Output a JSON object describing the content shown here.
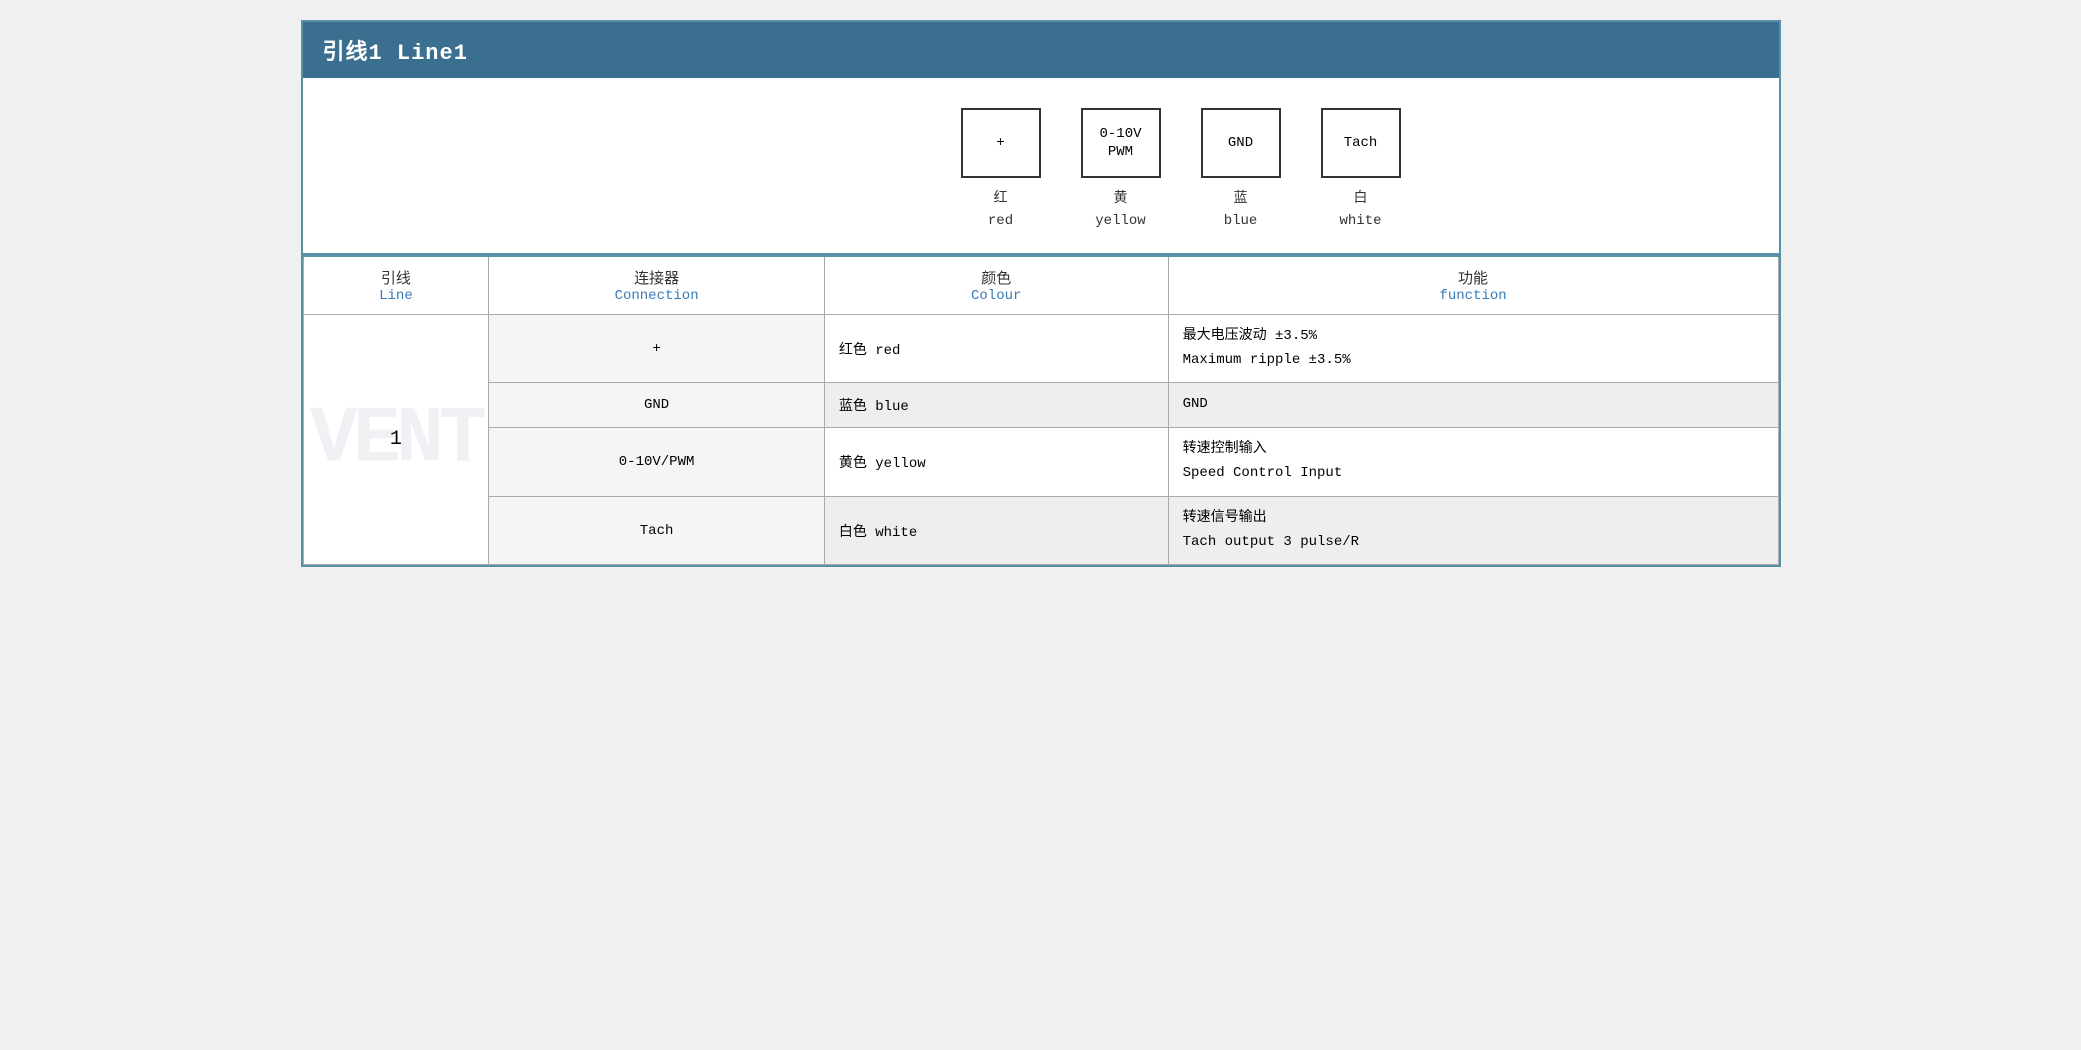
{
  "title": "引线1 Line1",
  "diagram": {
    "connectors": [
      {
        "id": "plus",
        "label": "+",
        "multiline": false
      },
      {
        "id": "pwm",
        "label": "0-10V\nPWM",
        "multiline": true
      },
      {
        "id": "gnd",
        "label": "GND",
        "multiline": false
      },
      {
        "id": "tach",
        "label": "Tach",
        "multiline": false
      }
    ],
    "labels": [
      {
        "zh": "红",
        "en": "red"
      },
      {
        "zh": "黄",
        "en": "yellow"
      },
      {
        "zh": "蓝",
        "en": "blue"
      },
      {
        "zh": "白",
        "en": "white"
      }
    ]
  },
  "table": {
    "headers": [
      {
        "zh": "引线",
        "en": "Line"
      },
      {
        "zh": "连接器",
        "en": "Connection"
      },
      {
        "zh": "颜色",
        "en": "Colour"
      },
      {
        "zh": "功能",
        "en": "function"
      }
    ],
    "rows": [
      {
        "line": "1",
        "connector": "+",
        "colour_zh": "红色",
        "colour_en": "red",
        "function_zh": "最大电压波动 ±3.5%",
        "function_en": "Maximum ripple ±3.5%",
        "shade": "normal"
      },
      {
        "line": "1",
        "connector": "GND",
        "colour_zh": "蓝色",
        "colour_en": "blue",
        "function_zh": "GND",
        "function_en": "",
        "shade": "shaded"
      },
      {
        "line": "1",
        "connector": "0-10V/PWM",
        "colour_zh": "黄色",
        "colour_en": "yellow",
        "function_zh": "转速控制输入",
        "function_en": "Speed Control Input",
        "shade": "normal"
      },
      {
        "line": "1",
        "connector": "Tach",
        "colour_zh": "白色",
        "colour_en": "white",
        "function_zh": "转速信号输出",
        "function_en": "Tach output 3 pulse/R",
        "shade": "shaded"
      }
    ]
  }
}
